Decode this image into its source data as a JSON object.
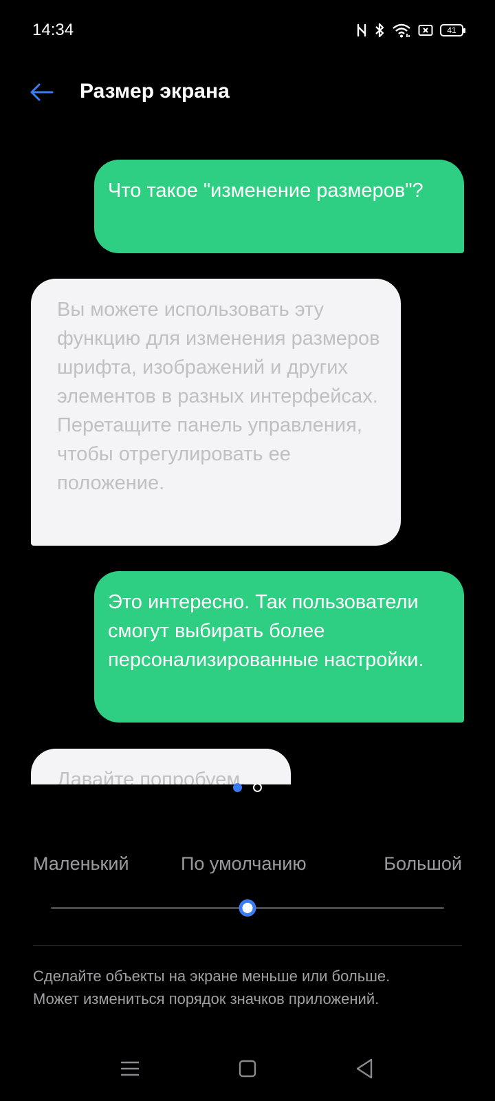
{
  "status_bar": {
    "time": "14:34",
    "battery": "41",
    "icons": [
      "nfc-icon",
      "bluetooth-icon",
      "wifi-icon",
      "screenshot-icon",
      "battery-icon"
    ]
  },
  "header": {
    "title": "Размер экрана",
    "back_icon": "arrow-left-icon"
  },
  "chat": {
    "messages": [
      {
        "side": "right",
        "style": "green",
        "text": "Что такое \"изменение размеров\"?"
      },
      {
        "side": "left",
        "style": "gray",
        "text": "Вы можете использовать эту функцию для изменения размеров шрифта, изображений и других элементов в разных интерфейсах. Перетащите панель управления, чтобы отрегулировать ее положение."
      },
      {
        "side": "right",
        "style": "green",
        "text": "Это интересно. Так пользователи смогут выбирать более персонализированные настройки."
      },
      {
        "side": "left",
        "style": "gray",
        "text": "Давайте попробуем."
      }
    ]
  },
  "pager": {
    "pages": 2,
    "current": 1
  },
  "size": {
    "labels": {
      "small": "Маленький",
      "default": "По умолчанию",
      "large": "Большой"
    },
    "slider_fraction": 0.5
  },
  "description": {
    "line1": "Сделайте объекты на экране меньше или больше.",
    "line2": "Может измениться порядок значков приложений."
  },
  "nav": {
    "icons": [
      "menu-icon",
      "home-icon",
      "back-triangle-icon"
    ]
  },
  "colors": {
    "accent": "#3a7cf4",
    "bubble_green": "#2ecf82",
    "bubble_gray": "#f4f4f6",
    "background": "#000000"
  }
}
